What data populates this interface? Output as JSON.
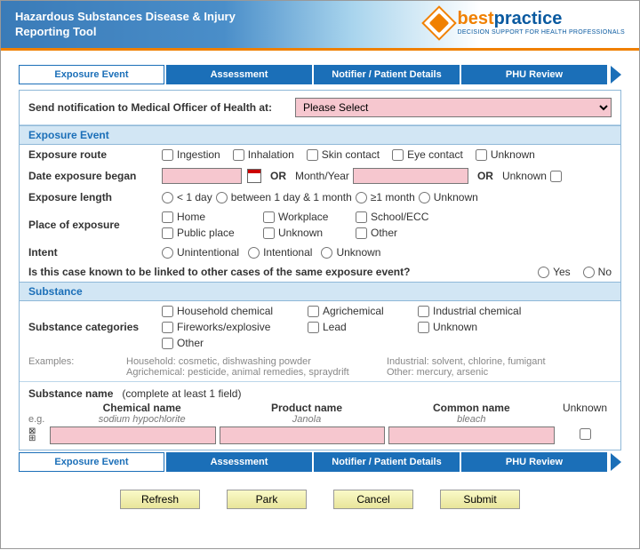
{
  "header": {
    "title": "Hazardous Substances Disease & Injury Reporting Tool"
  },
  "logo": {
    "word_orange": "best",
    "word_blue": "practice",
    "tagline": "DECISION SUPPORT FOR HEALTH PROFESSIONALS"
  },
  "tabs": {
    "t1": "Exposure Event",
    "t2": "Assessment",
    "t3": "Notifier / Patient Details",
    "t4": "PHU Review"
  },
  "notify": {
    "label": "Send notification to Medical Officer of Health at:",
    "selected": "Please Select"
  },
  "sections": {
    "exposure": "Exposure Event",
    "substance": "Substance"
  },
  "exposure": {
    "route_label": "Exposure route",
    "route": {
      "ingestion": "Ingestion",
      "inhalation": "Inhalation",
      "skin": "Skin contact",
      "eye": "Eye contact",
      "unknown": "Unknown"
    },
    "date_label": "Date exposure began",
    "or": "OR",
    "month_year": "Month/Year",
    "unknown": "Unknown",
    "length_label": "Exposure length",
    "length": {
      "lt1": "< 1 day",
      "btw": "between 1 day & 1 month",
      "ge1": "≥1 month",
      "unk": "Unknown"
    },
    "place_label": "Place of exposure",
    "place": {
      "home": "Home",
      "workplace": "Workplace",
      "school": "School/ECC",
      "public": "Public place",
      "unknown": "Unknown",
      "other": "Other"
    },
    "intent_label": "Intent",
    "intent": {
      "unint": "Unintentional",
      "int": "Intentional",
      "unk": "Unknown"
    },
    "linked_q": "Is this case known to be linked to other cases of the same exposure event?",
    "yes": "Yes",
    "no": "No"
  },
  "substance": {
    "cat_label": "Substance categories",
    "cats": {
      "household": "Household chemical",
      "agri": "Agrichemical",
      "industrial": "Industrial chemical",
      "fireworks": "Fireworks/explosive",
      "lead": "Lead",
      "unknown": "Unknown",
      "other": "Other"
    },
    "examples_label": "Examples:",
    "ex1a": "Household: cosmetic, dishwashing powder",
    "ex1b": "Agrichemical: pesticide, animal remedies, spraydrift",
    "ex2a": "Industrial: solvent, chlorine, fumigant",
    "ex2b": "Other: mercury, arsenic",
    "name_label": "Substance name",
    "name_hint": "(complete at least 1 field)",
    "cols": {
      "chem": "Chemical name",
      "prod": "Product name",
      "comm": "Common name",
      "unk": "Unknown"
    },
    "eg_label": "e.g.",
    "eg": {
      "chem": "sodium hypochlorite",
      "prod": "Janola",
      "comm": "bleach"
    }
  },
  "actions": {
    "refresh": "Refresh",
    "park": "Park",
    "cancel": "Cancel",
    "submit": "Submit"
  }
}
